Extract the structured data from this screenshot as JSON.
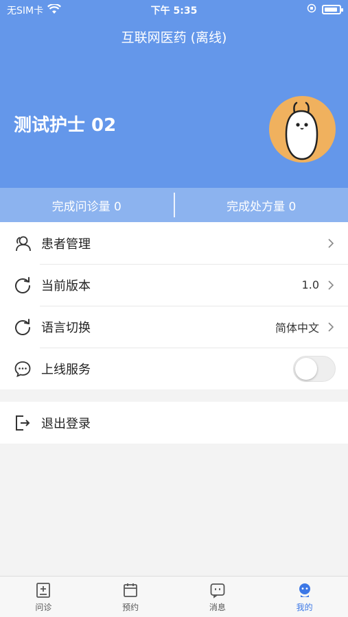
{
  "status_bar": {
    "carrier": "无SIM卡",
    "time": "下午 5:35"
  },
  "header": {
    "title": "互联网医药 (离线)",
    "username": "测试护士 02"
  },
  "stats": {
    "consultations": "完成问诊量 0",
    "prescriptions": "完成处方量 0"
  },
  "menu": [
    {
      "label": "患者管理",
      "value": "",
      "icon": "patient-icon"
    },
    {
      "label": "当前版本",
      "value": "1.0",
      "icon": "refresh-icon"
    },
    {
      "label": "语言切换",
      "value": "简体中文",
      "icon": "refresh-icon"
    },
    {
      "label": "上线服务",
      "value": "",
      "icon": "chat-bubble-icon",
      "toggle_on": false
    }
  ],
  "logout": {
    "label": "退出登录",
    "icon": "logout-icon"
  },
  "tabbar": [
    {
      "label": "问诊",
      "icon": "consult-icon"
    },
    {
      "label": "预约",
      "icon": "calendar-icon"
    },
    {
      "label": "消息",
      "icon": "message-icon"
    },
    {
      "label": "我的",
      "icon": "profile-icon",
      "active": true
    }
  ],
  "colors": {
    "header": "#6497ea",
    "stats": "#8cb3ef",
    "active_tab": "#3d78e6",
    "avatar_bg": "#f0b15e"
  }
}
